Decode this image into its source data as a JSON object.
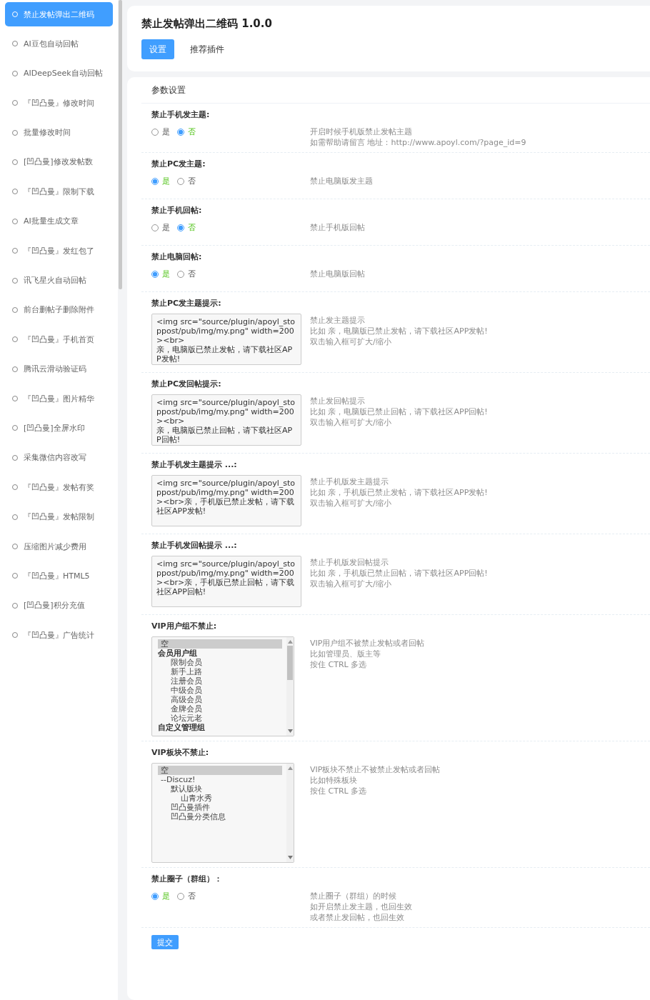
{
  "sidebar": {
    "items": [
      {
        "label": "禁止发帖弹出二维码",
        "selected": true
      },
      {
        "label": "AI豆包自动回帖",
        "selected": false
      },
      {
        "label": "AIDeepSeek自动回帖",
        "selected": false
      },
      {
        "label": "『凹凸曼』修改时间",
        "selected": false
      },
      {
        "label": "批量修改时间",
        "selected": false
      },
      {
        "label": "[凹凸曼]修改发帖数",
        "selected": false
      },
      {
        "label": "『凹凸曼』限制下载",
        "selected": false
      },
      {
        "label": "AI批量生成文章",
        "selected": false
      },
      {
        "label": "『凹凸曼』发红包了",
        "selected": false
      },
      {
        "label": "讯飞星火自动回帖",
        "selected": false
      },
      {
        "label": "前台删帖子删除附件",
        "selected": false
      },
      {
        "label": "『凹凸曼』手机首页",
        "selected": false
      },
      {
        "label": "腾讯云滑动验证码",
        "selected": false
      },
      {
        "label": "『凹凸曼』图片精华",
        "selected": false
      },
      {
        "label": "[凹凸曼]全屏水印",
        "selected": false
      },
      {
        "label": "采集微信内容改写",
        "selected": false
      },
      {
        "label": "『凹凸曼』发帖有奖",
        "selected": false
      },
      {
        "label": "『凹凸曼』发帖限制",
        "selected": false
      },
      {
        "label": "压缩图片减少费用",
        "selected": false
      },
      {
        "label": "『凹凸曼』HTML5",
        "selected": false
      },
      {
        "label": "[凹凸曼]积分充值",
        "selected": false
      },
      {
        "label": "『凹凸曼』广告统计",
        "selected": false
      }
    ]
  },
  "header": {
    "title": "禁止发帖弹出二维码 1.0.0",
    "tabs": [
      {
        "label": "设置",
        "selected": true
      },
      {
        "label": "推荐插件",
        "selected": false
      }
    ]
  },
  "settings": {
    "heading": "参数设置",
    "fields": [
      {
        "kind": "radio",
        "label": "禁止手机发主题:",
        "options": [
          {
            "label": "是",
            "selected": false
          },
          {
            "label": "否",
            "selected": true
          }
        ],
        "help": [
          "开启时候手机版禁止发帖主题",
          "如需帮助请留言 地址：http://www.apoyl.com/?page_id=9"
        ]
      },
      {
        "kind": "radio",
        "label": "禁止PC发主题:",
        "options": [
          {
            "label": "是",
            "selected": true
          },
          {
            "label": "否",
            "selected": false
          }
        ],
        "help": [
          "禁止电脑版发主题"
        ]
      },
      {
        "kind": "radio",
        "label": "禁止手机回帖:",
        "options": [
          {
            "label": "是",
            "selected": false
          },
          {
            "label": "否",
            "selected": true
          }
        ],
        "help": [
          "禁止手机版回帖"
        ]
      },
      {
        "kind": "radio",
        "label": "禁止电脑回帖:",
        "options": [
          {
            "label": "是",
            "selected": true
          },
          {
            "label": "否",
            "selected": false
          }
        ],
        "help": [
          "禁止电脑版回帖"
        ]
      },
      {
        "kind": "textarea",
        "label": "禁止PC发主题提示:",
        "value": "<img src=\"source/plugin/apoyl_stoppost/pub/img/my.png\" width=200><br>\n亲，电脑版已禁止发帖，请下载社区APP发帖!",
        "help": [
          "禁止发主题提示",
          "比如 亲，电脑版已禁止发帖，请下载社区APP发帖!",
          "双击输入框可扩大/缩小"
        ]
      },
      {
        "kind": "textarea",
        "label": "禁止PC发回帖提示:",
        "value": "<img src=\"source/plugin/apoyl_stoppost/pub/img/my.png\" width=200><br>\n亲，电脑版已禁止回帖，请下载社区APP回帖!",
        "help": [
          "禁止发回帖提示",
          "比如 亲，电脑版已禁止回帖，请下载社区APP回帖!",
          "双击输入框可扩大/缩小"
        ]
      },
      {
        "kind": "textarea",
        "label": "禁止手机发主题提示 ...:",
        "value": "<img src=\"source/plugin/apoyl_stoppost/pub/img/my.png\" width=200><br>亲，手机版已禁止发帖，请下载社区APP发帖!",
        "help": [
          "禁止手机版发主题提示",
          "比如 亲，手机版已禁止发帖，请下载社区APP发帖!",
          "双击输入框可扩大/缩小"
        ]
      },
      {
        "kind": "textarea",
        "label": "禁止手机发回帖提示 ...:",
        "value": "<img src=\"source/plugin/apoyl_stoppost/pub/img/my.png\" width=200><br>亲，手机版已禁止回帖，请下载社区APP回帖!",
        "help": [
          "禁止手机版发回帖提示",
          "比如 亲，手机版已禁止回帖，请下载社区APP回帖!",
          "双击输入框可扩大/缩小"
        ]
      },
      {
        "kind": "select",
        "label": "VIP用户组不禁止:",
        "options": [
          {
            "kind": "option",
            "label": "空",
            "selected": true
          },
          {
            "kind": "group",
            "label": "会员用户组",
            "selected": false,
            "children": [
              {
                "kind": "option",
                "label": "限制会员",
                "selected": false
              },
              {
                "kind": "option",
                "label": "新手上路",
                "selected": false
              },
              {
                "kind": "option",
                "label": "注册会员",
                "selected": false
              },
              {
                "kind": "option",
                "label": "中级会员",
                "selected": false
              },
              {
                "kind": "option",
                "label": "高级会员",
                "selected": false
              },
              {
                "kind": "option",
                "label": "金牌会员",
                "selected": false
              },
              {
                "kind": "option",
                "label": "论坛元老",
                "selected": false
              }
            ]
          },
          {
            "kind": "group",
            "label": "自定义管理组",
            "selected": false
          }
        ],
        "help": [
          "VIP用户组不被禁止发帖或者回帖",
          "比如管理员、版主等",
          "按住 CTRL 多选"
        ]
      },
      {
        "kind": "select",
        "label": "VIP板块不禁止:",
        "options": [
          {
            "kind": "option",
            "label": "空",
            "selected": true
          },
          {
            "kind": "option",
            "label": "--Discuz!",
            "selected": false,
            "children": [
              {
                "kind": "option",
                "label": "默认版块",
                "selected": false,
                "children": [
                  {
                    "kind": "option",
                    "label": "山青水秀",
                    "selected": false
                  }
                ]
              },
              {
                "kind": "option",
                "label": "凹凸曼插件",
                "selected": false
              },
              {
                "kind": "option",
                "label": "凹凸曼分类信息",
                "selected": false
              }
            ]
          }
        ],
        "help": [
          "VIP板块不禁止不被禁止发帖或者回帖",
          "比如特殊板块",
          "按住 CTRL 多选"
        ]
      },
      {
        "kind": "radio",
        "label": "禁止圈子（群组）：",
        "options": [
          {
            "label": "是",
            "selected": true
          },
          {
            "label": "否",
            "selected": false
          }
        ],
        "help": [
          "禁止圈子（群组）的时候",
          "如开启禁止发主题，也回生效",
          "或者禁止发回帖，也回生效"
        ]
      }
    ],
    "submit": "提交"
  }
}
